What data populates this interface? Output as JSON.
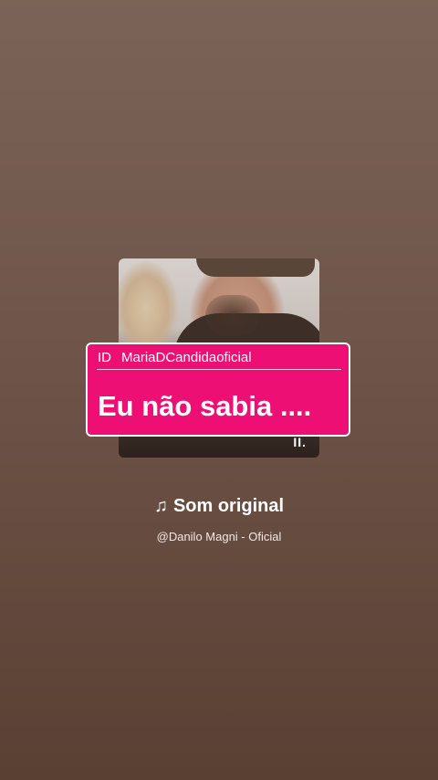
{
  "story": {
    "sticker": {
      "id_label": "ID",
      "username": "MariaDCandidaoficial",
      "message": "Eu não sabia ...."
    },
    "pause_symbol": "II.",
    "music": {
      "note_symbol": "♫",
      "title": "Som original",
      "artist": "@Danilo Magni - Oficial"
    }
  },
  "colors": {
    "sticker_background": "#ed0f73",
    "sticker_border": "#ffffff",
    "page_background": "#6f5549"
  },
  "icons": {
    "music": "music-note-icon",
    "playback": "pause-icon"
  }
}
